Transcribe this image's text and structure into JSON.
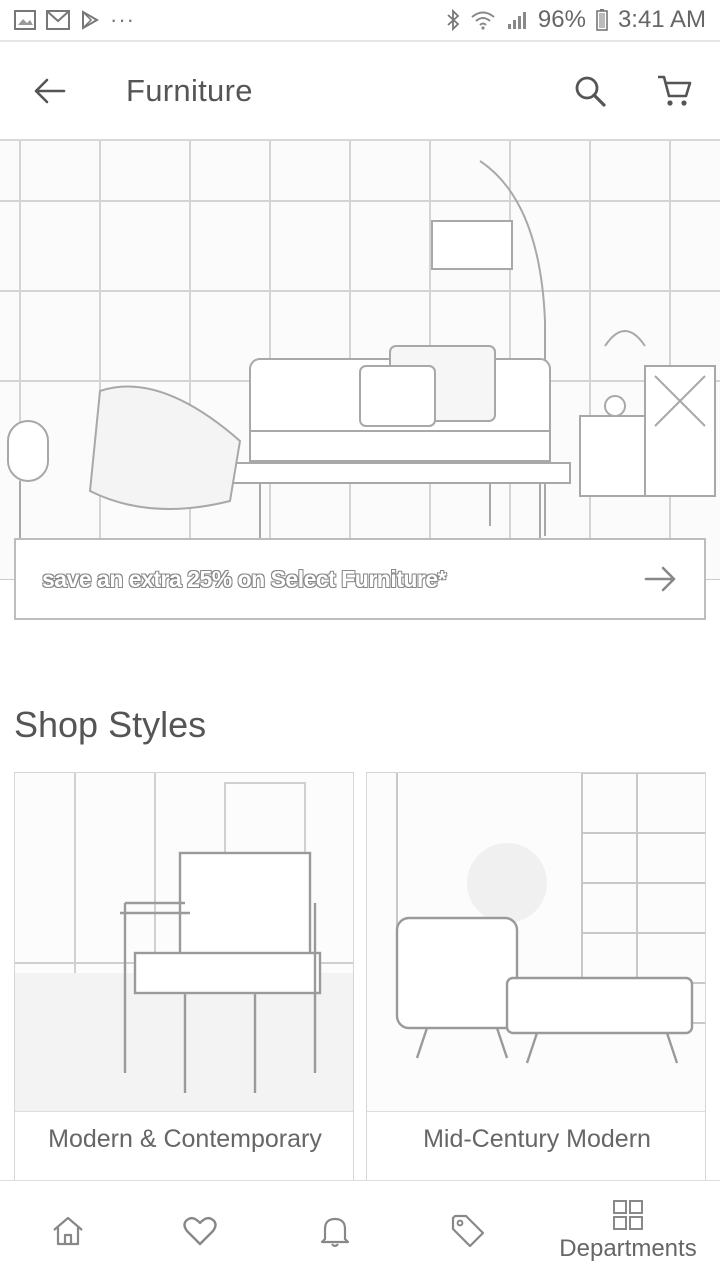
{
  "status_bar": {
    "battery": "96%",
    "time": "3:41 AM",
    "more": "···",
    "icons": [
      "image-notification-icon",
      "gmail-icon",
      "play-store-icon",
      "bluetooth-icon",
      "wifi-icon",
      "signal-icon",
      "battery-icon"
    ]
  },
  "app_bar": {
    "title": "Furniture",
    "icons": [
      "back-arrow-icon",
      "search-icon",
      "cart-icon"
    ]
  },
  "promo": {
    "text": "save an extra 25% on Select Furniture*",
    "icon": "arrow-right-icon"
  },
  "shop_styles": {
    "title": "Shop Styles",
    "cards": [
      {
        "label": "Modern & Contemporary"
      },
      {
        "label": "Mid-Century Modern"
      }
    ]
  },
  "bottom_nav": {
    "items": [
      {
        "icon": "home-icon",
        "label": ""
      },
      {
        "icon": "heart-icon",
        "label": ""
      },
      {
        "icon": "bell-icon",
        "label": ""
      },
      {
        "icon": "tag-icon",
        "label": ""
      },
      {
        "icon": "grid-icon",
        "label": "Departments"
      }
    ]
  },
  "colors": {
    "text": "#555555",
    "line": "#bdbdbd",
    "background": "#ffffff"
  }
}
